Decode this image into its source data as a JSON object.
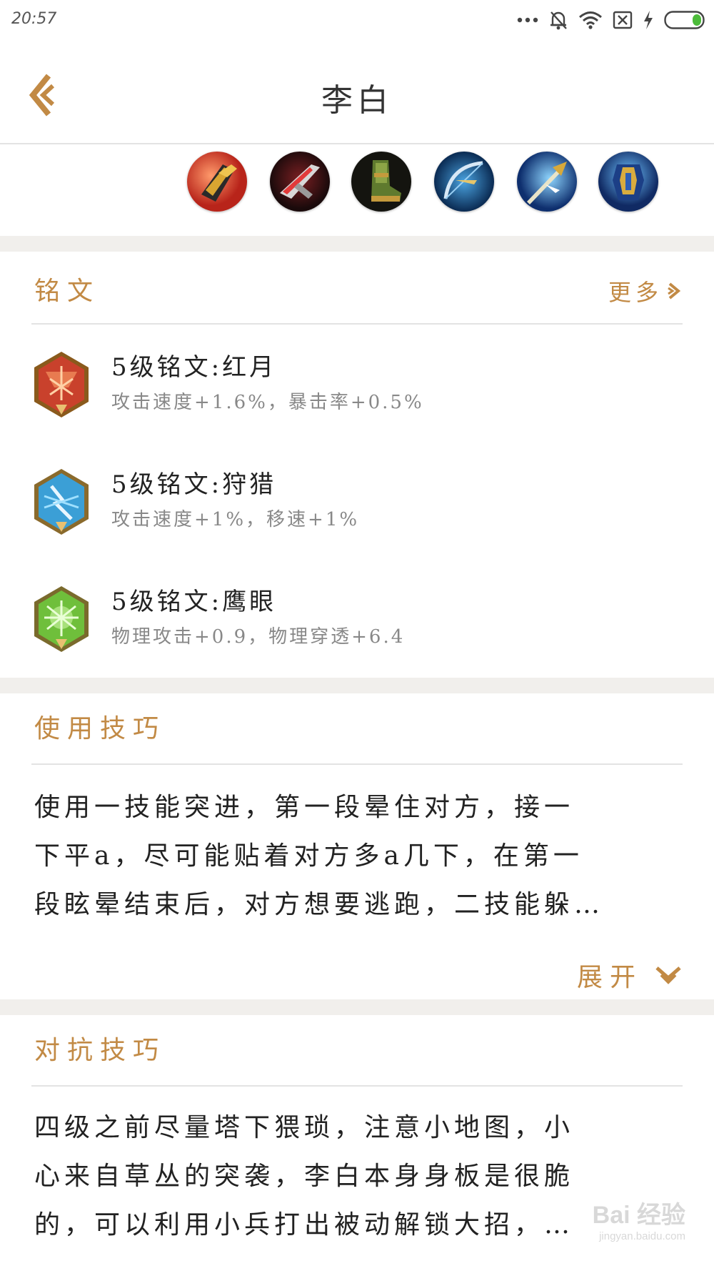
{
  "status_bar": {
    "time": "20:57",
    "icons": [
      "more-dots-icon",
      "bell-muted-icon",
      "wifi-icon",
      "sim-none-icon",
      "charging-icon",
      "battery-icon"
    ]
  },
  "header": {
    "title": "李白",
    "back_icon": "back-arrow-icon"
  },
  "items": [
    {
      "icon": "item-golden-gauntlet-icon"
    },
    {
      "icon": "item-red-blade-icon"
    },
    {
      "icon": "item-green-boots-icon"
    },
    {
      "icon": "item-blue-bow-icon"
    },
    {
      "icon": "item-blue-spear-icon"
    },
    {
      "icon": "item-blue-armor-icon"
    }
  ],
  "runes": {
    "title": "铭文",
    "more_label": "更多",
    "list": [
      {
        "name": "5级铭文:红月",
        "desc": "攻击速度+1.6%，暴击率+0.5%",
        "color": "#c9412c"
      },
      {
        "name": "5级铭文:狩猎",
        "desc": "攻击速度+1%，移速+1%",
        "color": "#3b9fd6"
      },
      {
        "name": "5级铭文:鹰眼",
        "desc": "物理攻击+0.9，物理穿透+6.4",
        "color": "#6fbf3b"
      }
    ]
  },
  "usage": {
    "title": "使用技巧",
    "lines": [
      "使用一技能突进，第一段晕住对方，接一",
      "下平a，尽可能贴着对方多a几下，在第一",
      "段眩晕结束后，对方想要逃跑，二技能躲…"
    ],
    "expand_label": "展开"
  },
  "counter": {
    "title": "对抗技巧",
    "lines": [
      "四级之前尽量塔下猥琐，注意小地图，小",
      "心来自草丛的突袭，李白本身身板是很脆",
      "的，可以利用小兵打出被动解锁大招，…"
    ]
  },
  "watermark": {
    "main": "Bai 经验",
    "sub": "jingyan.baidu.com"
  },
  "colors": {
    "accent": "#c28a45",
    "divider": "#e3e3e3",
    "section_gap": "#f1efec"
  }
}
